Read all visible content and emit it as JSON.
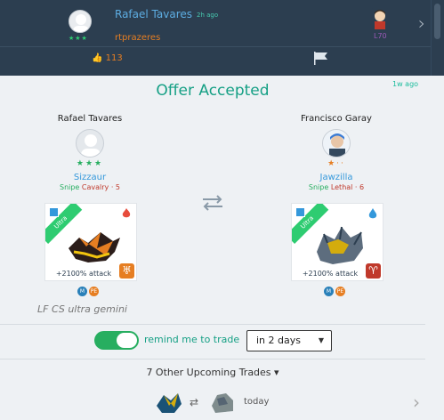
{
  "header": {
    "name": "Rafael Tavares",
    "time": "2h ago",
    "username": "rtprazeres",
    "stars": "★★★",
    "level": "L70",
    "likes": "113"
  },
  "offer": {
    "title": "Offer Accepted",
    "time": "1w ago",
    "left": {
      "name": "Rafael Tavares",
      "stars": "★★★",
      "monster": "Sizzaur",
      "skill_type": "Snipe",
      "skill_name": "Cavalry · 5",
      "ribbon": "Ultra",
      "attack": "+2100% attack",
      "rune": "♅",
      "badges": [
        "M",
        "PE"
      ],
      "colors": {
        "element": "#e74c3c",
        "rune": "#e67e22"
      }
    },
    "right": {
      "name": "Francisco Garay",
      "stars": "★··",
      "monster": "Jawzilla",
      "skill_type": "Snipe",
      "skill_name": "Lethal · 6",
      "ribbon": "Ultra",
      "attack": "+2100% attack",
      "rune": "♈",
      "badges": [
        "M",
        "PE"
      ],
      "colors": {
        "element": "#3498db",
        "rune": "#c0392b"
      }
    },
    "note": "LF CS ultra gemini"
  },
  "reminder": {
    "label": "remind me to trade",
    "select_value": "in 2 days",
    "enabled": true
  },
  "upcoming": {
    "label": "7 Other Upcoming Trades ▾",
    "item_time": "today"
  }
}
